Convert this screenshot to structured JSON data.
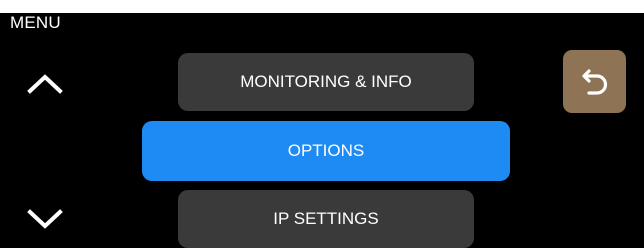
{
  "header": {
    "title": "MENU"
  },
  "nav": {
    "up_icon": "chevron-up-icon",
    "down_icon": "chevron-down-icon"
  },
  "menu": {
    "items": [
      {
        "label": "MONITORING & INFO",
        "selected": false
      },
      {
        "label": "OPTIONS",
        "selected": true
      },
      {
        "label": "IP SETTINGS",
        "selected": false
      }
    ]
  },
  "back": {
    "icon": "back-arrow-icon"
  },
  "colors": {
    "background": "#000000",
    "item_normal": "#3a3a3a",
    "item_selected": "#1e8bf5",
    "back_button": "#8e7455",
    "text": "#ffffff"
  }
}
